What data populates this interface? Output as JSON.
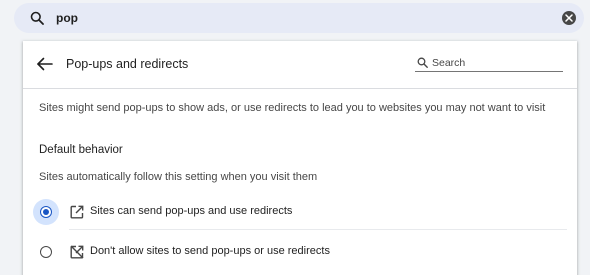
{
  "topbar": {
    "query": "pop",
    "search_icon": "search-icon",
    "clear_icon": "close-icon"
  },
  "panel": {
    "back_icon": "arrow-back-icon",
    "title": "Pop-ups and redirects",
    "search_placeholder": "Search",
    "description": "Sites might send pop-ups to show ads, or use redirects to lead you to websites you may not want to visit",
    "section_heading": "Default behavior",
    "section_sub": "Sites automatically follow this setting when you visit them",
    "options": [
      {
        "label": "Sites can send pop-ups and use redirects",
        "icon": "open-in-new-icon",
        "selected": true
      },
      {
        "label": "Don't allow sites to send pop-ups or use redirects",
        "icon": "blocked-popup-icon",
        "selected": false
      }
    ]
  },
  "colors": {
    "accent": "#1a56c4",
    "selected_halo": "#d3e3fd",
    "searchbar": "#e6eaf6"
  }
}
